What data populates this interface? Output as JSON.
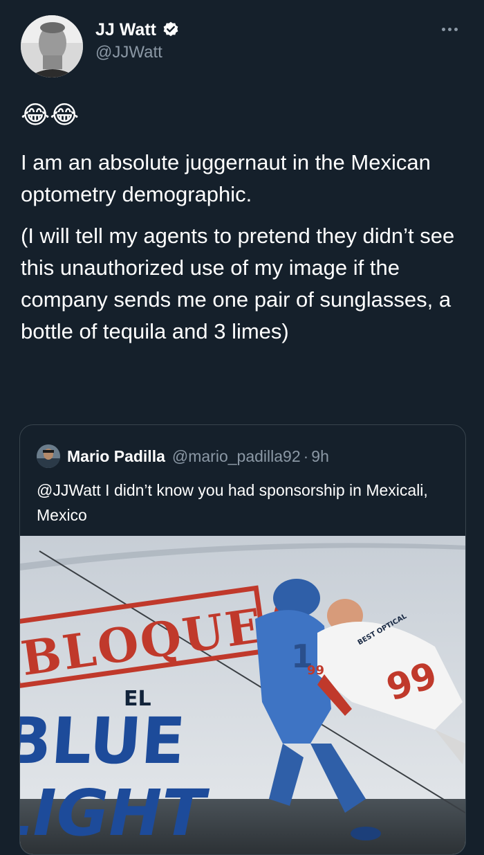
{
  "author": {
    "display_name": "JJ Watt",
    "handle": "@JJWatt",
    "verified": true
  },
  "tweet": {
    "emoji": "😂😂",
    "paragraph_1": "I am an absolute juggernaut in the Mexican optometry demographic.",
    "paragraph_2": "(I will tell my agents to pretend they didn’t see this unauthorized use of my image if the company sends me one pair of sunglasses, a bottle of tequila and 3 limes)"
  },
  "quoted_tweet": {
    "display_name": "Mario Padilla",
    "handle": "@mario_padilla92",
    "separator": "·",
    "time": "9h",
    "mention": "@JJWatt",
    "text": " I didn’t know you had sponsorship in Mexicali, Mexico",
    "image": {
      "stamp_text": "BLOQUEA",
      "el_text": "EL",
      "blue_text": "BLUE",
      "light_text": "LIGHT",
      "jersey_number": "99",
      "sleeve_number": "99",
      "helmet_number": "1",
      "sponsor_text": "BEST OPTICAL"
    }
  },
  "colors": {
    "background": "#15202b",
    "text_primary": "#ffffff",
    "text_secondary": "#8b98a5",
    "border": "#38444d",
    "verified_badge": "#ffffff"
  },
  "icons": {
    "verified": "verified-badge-icon",
    "more": "more-options-icon"
  }
}
